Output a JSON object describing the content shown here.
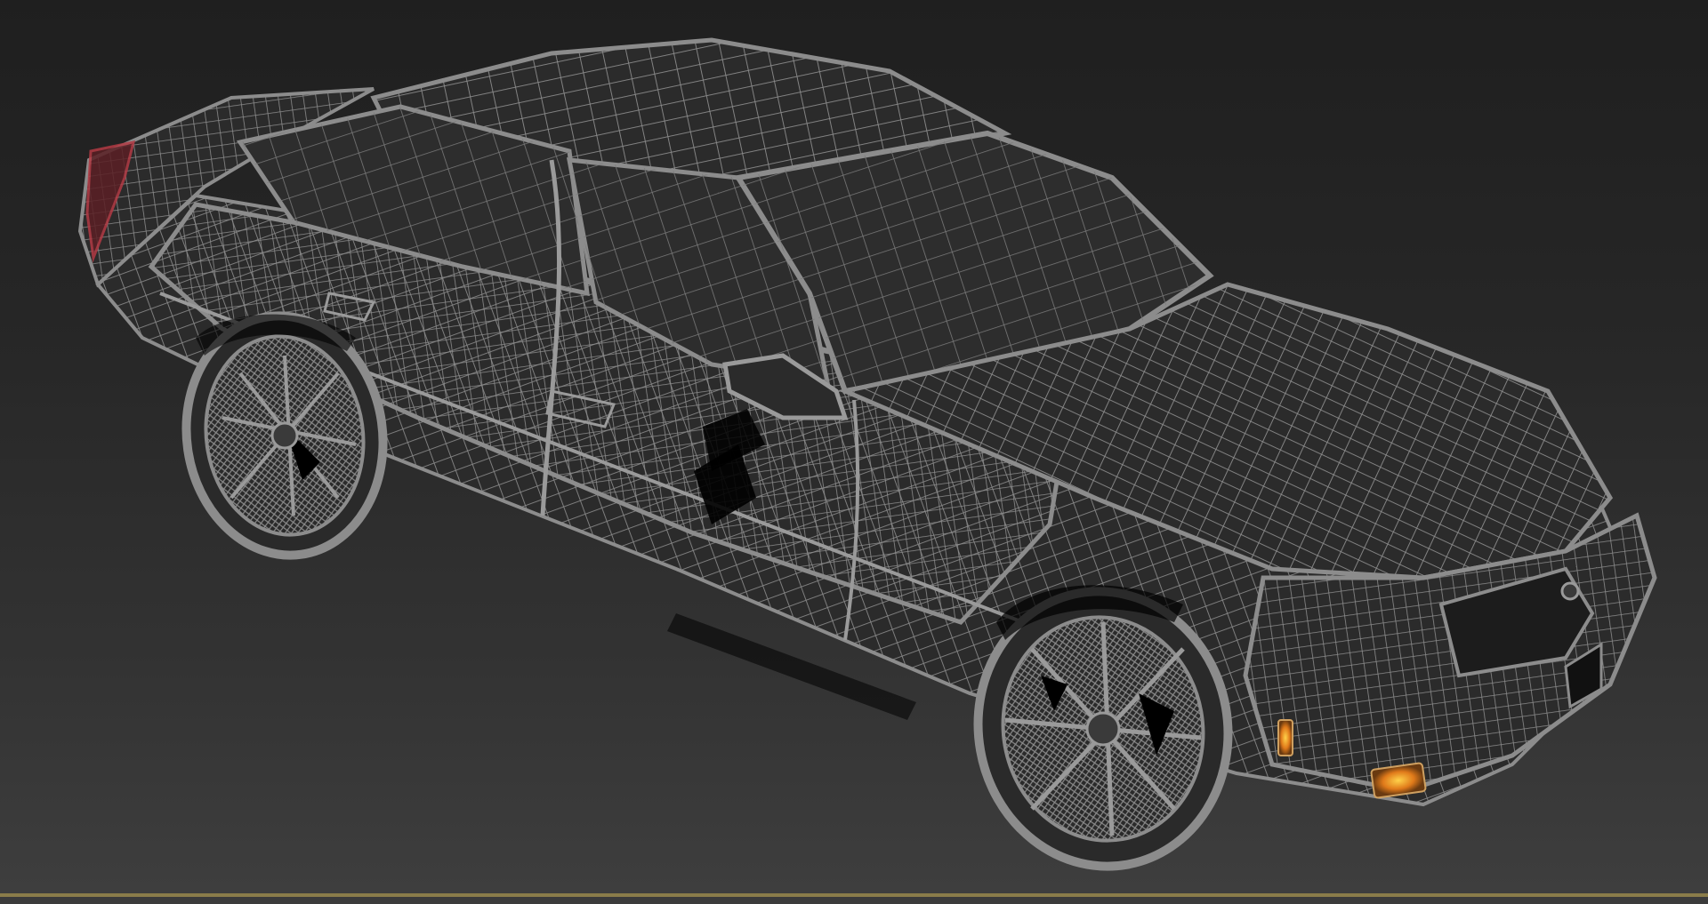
{
  "viewport": {
    "background_top": "#1f1f1f",
    "background_bottom": "#3e3e3e",
    "wire_color": "#8c8c8c",
    "wire_dark": "#6f6f6f",
    "shade_color": "#000000",
    "model": "sedan-wireframe",
    "active_border_color": "#8a7c4a"
  }
}
